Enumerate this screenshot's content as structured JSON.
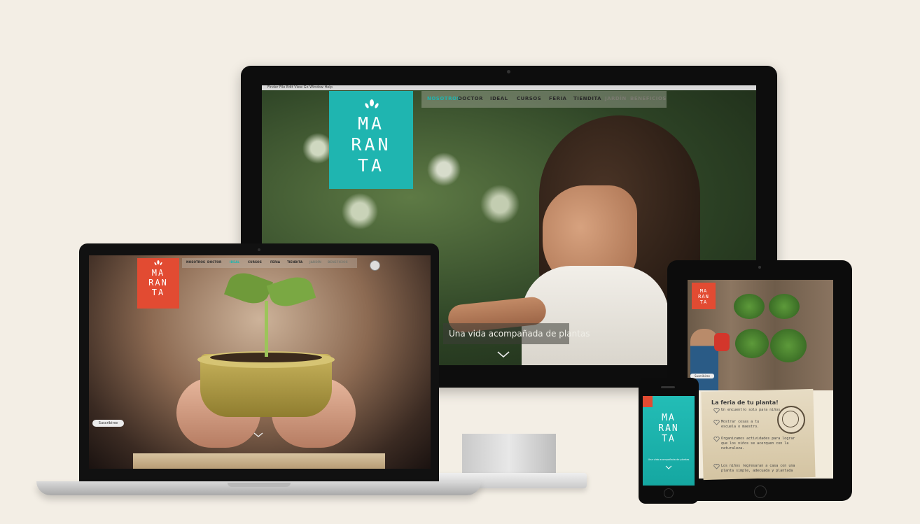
{
  "brand": {
    "name_lines": "MA\nRAN\nTA",
    "teal": "#1fb5b0",
    "coral": "#e24b32",
    "cream_background": "#f3eee5"
  },
  "desktop": {
    "menubar_text": "Finder  File  Edit  View  Go  Window  Help",
    "nav": [
      {
        "label": "NOSOTROS",
        "color": "#1fb5b0"
      },
      {
        "label": "DOCTOR",
        "color": "#2a2a2a"
      },
      {
        "label": "IDEAL",
        "color": "#2a2a2a"
      },
      {
        "label": "CURSOS",
        "color": "#2a2a2a"
      },
      {
        "label": "FERIA",
        "color": "#2a2a2a"
      },
      {
        "label": "TIENDITA",
        "color": "#2a2a2a"
      },
      {
        "label": "JARDÍN",
        "color": "#7a7a70"
      },
      {
        "label": "BENEFICIOS",
        "color": "#7a7a70"
      }
    ],
    "tagline": "Una vida acompañada de plantas",
    "scroll_icon": "chevron-down-icon"
  },
  "laptop": {
    "nav": [
      {
        "label": "NOSOTROS",
        "color": "#2a2a2a"
      },
      {
        "label": "DOCTOR",
        "color": "#2a2a2a"
      },
      {
        "label": "IDEAL",
        "color": "#1fb5b0"
      },
      {
        "label": "CURSOS",
        "color": "#2a2a2a"
      },
      {
        "label": "FERIA",
        "color": "#2a2a2a"
      },
      {
        "label": "TIENDITA",
        "color": "#2a2a2a"
      },
      {
        "label": "JARDÍN",
        "color": "#7a7a70"
      },
      {
        "label": "BENEFICIOS",
        "color": "#7a7a70"
      }
    ],
    "badge": "Suscribirse",
    "scroll_icon": "chevron-down-icon"
  },
  "tablet": {
    "badge": "Suscribirse",
    "paper_title": "La feria de tu planta!",
    "paper_lines": [
      "Un encuentro solo para niños.",
      "Mostrar cosas a tu",
      "escuela o maestro.",
      "Organizamos actividades para lograr",
      "que los niños se acerquen con la",
      "naturaleza.",
      "Los niños regresaran a casa con una",
      "planta simple, adecuada y plantada"
    ]
  },
  "phone": {
    "tagline": "Una vida acompañada de plantas",
    "scroll_icon": "chevron-down-icon"
  }
}
